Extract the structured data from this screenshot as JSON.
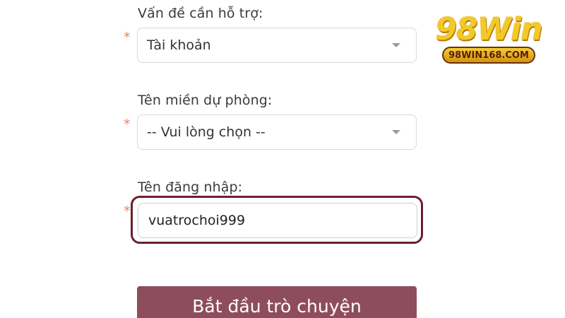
{
  "form": {
    "issue": {
      "label": "Vấn đề cần hỗ trợ:",
      "required_mark": "*",
      "selected": "Tài khoản"
    },
    "backup_domain": {
      "label": "Tên miền dự phòng:",
      "required_mark": "*",
      "selected": "-- Vui lòng chọn --"
    },
    "username": {
      "label": "Tên đăng nhập:",
      "required_mark": "*",
      "value": "vuatrochoi999"
    },
    "start_button": "Bắt đầu trò chuyện"
  },
  "logo": {
    "brand": "98Win",
    "url": "98WIN168.COM"
  },
  "colors": {
    "required": "#e8836a",
    "focus_outline": "#6b1f2e",
    "button_bg": "#8e4d5c",
    "logo_gold": "#f3c928"
  }
}
